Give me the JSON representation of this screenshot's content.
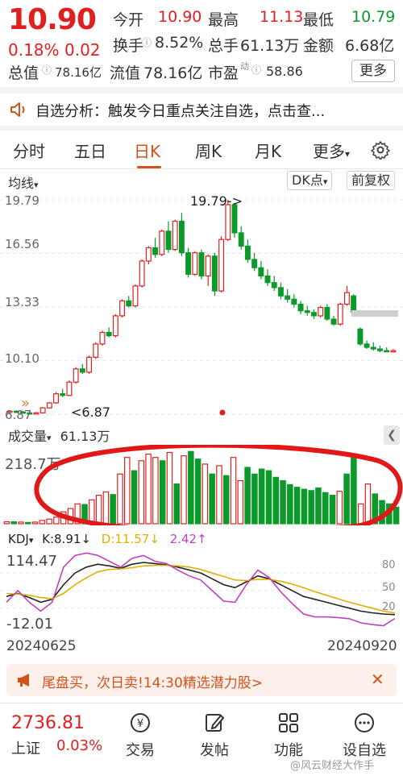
{
  "quote": {
    "price": "10.90",
    "change_pct": "0.18%",
    "change": "0.02",
    "rows": [
      [
        {
          "label": "今开",
          "value": "10.90",
          "color": "red"
        },
        {
          "label": "最高",
          "value": "11.13",
          "color": "red"
        },
        {
          "label": "最低",
          "value": "10.79",
          "color": "green"
        }
      ],
      [
        {
          "label": "换手",
          "value": "8.52%",
          "color": "gray"
        },
        {
          "label": "总手",
          "value": "61.13万",
          "color": "gray"
        },
        {
          "label": "金额",
          "value": "6.68亿",
          "color": "gray"
        }
      ],
      [
        {
          "label": "总值",
          "value": "78.16亿",
          "color": "gray"
        },
        {
          "label": "流值",
          "value": "78.16亿",
          "color": "gray"
        },
        {
          "label": "市盈",
          "value": "58.86",
          "color": "gray"
        }
      ]
    ],
    "more_button": "更多"
  },
  "notice": {
    "text": "自选分析：触发今日重点关注自选，点击查..."
  },
  "tabs": [
    {
      "label": "分时"
    },
    {
      "label": "五日"
    },
    {
      "label": "日K",
      "active": true
    },
    {
      "label": "周K"
    },
    {
      "label": "月K"
    },
    {
      "label": "更多"
    }
  ],
  "chart_toolbar": {
    "ma_label": "均线",
    "dk_label": "DK点",
    "adjust_label": "前复权"
  },
  "chart_data": [
    {
      "type": "candlestick",
      "y_ticks": [
        "19.79",
        "16.56",
        "13.33",
        "10.10",
        "6.87"
      ],
      "ylim": [
        6.87,
        19.79
      ],
      "annotations": {
        "max": "19.79->",
        "min": "<6.87"
      },
      "candles": [
        [
          7.0,
          7.1,
          6.95,
          7.05
        ],
        [
          7.05,
          7.1,
          6.95,
          7.0
        ],
        [
          7.0,
          7.05,
          6.9,
          6.95
        ],
        [
          6.95,
          7.0,
          6.88,
          6.92
        ],
        [
          6.92,
          7.0,
          6.87,
          6.95
        ],
        [
          6.95,
          7.3,
          6.9,
          7.25
        ],
        [
          7.25,
          7.6,
          7.2,
          7.55
        ],
        [
          7.55,
          8.2,
          7.5,
          8.1
        ],
        [
          8.1,
          8.4,
          7.9,
          8.0
        ],
        [
          8.0,
          8.9,
          7.95,
          8.8
        ],
        [
          8.8,
          9.7,
          8.7,
          9.6
        ],
        [
          9.6,
          9.9,
          9.3,
          9.4
        ],
        [
          9.4,
          10.4,
          9.3,
          10.3
        ],
        [
          10.3,
          11.2,
          10.2,
          11.1
        ],
        [
          11.1,
          11.9,
          11.0,
          11.8
        ],
        [
          11.8,
          12.1,
          11.5,
          11.6
        ],
        [
          11.6,
          12.9,
          11.5,
          12.8
        ],
        [
          12.8,
          13.8,
          12.7,
          13.7
        ],
        [
          13.7,
          14.0,
          13.3,
          13.4
        ],
        [
          13.4,
          14.7,
          13.3,
          14.6
        ],
        [
          14.6,
          16.2,
          14.5,
          16.1
        ],
        [
          16.1,
          17.0,
          15.9,
          16.9
        ],
        [
          16.9,
          17.5,
          16.3,
          16.5
        ],
        [
          16.5,
          18.0,
          16.4,
          17.9
        ],
        [
          17.9,
          18.5,
          16.6,
          16.8
        ],
        [
          16.8,
          18.6,
          16.7,
          18.5
        ],
        [
          18.5,
          19.0,
          16.4,
          16.6
        ],
        [
          16.6,
          16.9,
          15.1,
          15.3
        ],
        [
          15.3,
          16.7,
          15.2,
          16.6
        ],
        [
          16.6,
          16.8,
          15.0,
          15.2
        ],
        [
          15.2,
          16.5,
          14.6,
          16.4
        ],
        [
          16.4,
          16.6,
          14.0,
          14.3
        ],
        [
          14.3,
          17.6,
          14.2,
          17.4
        ],
        [
          17.4,
          19.79,
          17.3,
          19.5
        ],
        [
          19.5,
          19.6,
          17.5,
          17.8
        ],
        [
          17.8,
          18.2,
          16.8,
          17.0
        ],
        [
          17.0,
          17.4,
          16.0,
          16.2
        ],
        [
          16.2,
          16.6,
          15.5,
          15.7
        ],
        [
          15.7,
          16.1,
          15.0,
          15.2
        ],
        [
          15.2,
          15.6,
          14.6,
          14.8
        ],
        [
          14.8,
          15.2,
          14.3,
          14.5
        ],
        [
          14.5,
          14.8,
          13.8,
          14.0
        ],
        [
          14.0,
          14.4,
          13.6,
          13.8
        ],
        [
          13.8,
          14.1,
          13.3,
          13.5
        ],
        [
          13.5,
          13.7,
          12.9,
          13.1
        ],
        [
          13.1,
          13.4,
          12.8,
          13.0
        ],
        [
          13.0,
          13.2,
          12.6,
          12.8
        ],
        [
          12.8,
          13.4,
          12.7,
          13.3
        ],
        [
          13.3,
          13.5,
          12.5,
          12.6
        ],
        [
          12.6,
          12.8,
          12.2,
          12.3
        ],
        [
          12.3,
          13.6,
          12.2,
          13.5
        ],
        [
          13.5,
          14.6,
          13.4,
          14.2
        ],
        [
          14.0,
          14.1,
          12.9,
          13.0
        ],
        [
          12.0,
          12.1,
          11.0,
          11.1
        ],
        [
          11.1,
          11.3,
          10.8,
          10.9
        ],
        [
          10.9,
          11.2,
          10.7,
          10.8
        ],
        [
          10.8,
          11.0,
          10.6,
          10.7
        ],
        [
          10.7,
          10.9,
          10.6,
          10.65
        ],
        [
          10.65,
          10.8,
          10.6,
          10.7
        ]
      ]
    },
    {
      "type": "bar",
      "title": "成交量",
      "total_label": "61.13万",
      "y_tick": "218.7万",
      "ylim": [
        0,
        218.7
      ],
      "values": [
        6,
        6,
        5,
        4,
        5,
        10,
        14,
        20,
        36,
        46,
        60,
        58,
        72,
        86,
        96,
        88,
        150,
        200,
        160,
        190,
        210,
        200,
        190,
        215,
        120,
        205,
        218,
        195,
        180,
        150,
        175,
        145,
        200,
        130,
        170,
        150,
        165,
        160,
        140,
        130,
        118,
        110,
        104,
        100,
        108,
        94,
        86,
        98,
        150,
        200,
        60,
        120,
        90,
        70,
        60,
        50
      ],
      "rise": [
        1,
        0,
        1,
        0,
        1,
        1,
        1,
        1,
        1,
        1,
        1,
        0,
        1,
        1,
        1,
        0,
        1,
        1,
        0,
        1,
        1,
        1,
        0,
        1,
        0,
        1,
        0,
        0,
        1,
        0,
        1,
        0,
        1,
        1,
        0,
        0,
        0,
        0,
        0,
        0,
        0,
        0,
        0,
        0,
        0,
        0,
        0,
        1,
        0,
        0,
        1,
        1,
        0,
        0,
        0,
        0
      ]
    },
    {
      "type": "line",
      "title": "KDJ",
      "k_label": "K:8.91",
      "d_label": "D:11.57",
      "j_label": "2.42",
      "y_top": "114.47",
      "y_bottom": "-12.01",
      "right_ticks": [
        "80",
        "50",
        "20"
      ],
      "ylim": [
        -12.01,
        114.47
      ],
      "x_start": "20240625",
      "x_end": "20240920",
      "series": [
        {
          "color": "#222222",
          "values": [
            40,
            45,
            38,
            30,
            35,
            60,
            80,
            90,
            95,
            92,
            88,
            95,
            98,
            96,
            94,
            90,
            85,
            80,
            70,
            60,
            55,
            65,
            75,
            70,
            60,
            50,
            40,
            35,
            30,
            25,
            20,
            15,
            12,
            10,
            8.91
          ]
        },
        {
          "color": "#e0b000",
          "values": [
            45,
            44,
            42,
            38,
            36,
            45,
            60,
            72,
            82,
            86,
            87,
            89,
            92,
            93,
            93,
            92,
            90,
            86,
            80,
            74,
            68,
            67,
            69,
            69,
            66,
            61,
            55,
            48,
            42,
            36,
            30,
            25,
            20,
            15,
            11.57
          ]
        },
        {
          "color": "#c040c0",
          "values": [
            30,
            50,
            30,
            15,
            30,
            90,
            110,
            114,
            110,
            100,
            90,
            105,
            110,
            100,
            96,
            85,
            75,
            68,
            50,
            32,
            30,
            60,
            85,
            72,
            48,
            28,
            10,
            5,
            5,
            4,
            2,
            -5,
            -8,
            -10,
            2.42
          ]
        }
      ]
    }
  ],
  "ad_banner": {
    "text": "尾盘买，次日卖!14:30精选潜力股>"
  },
  "bottom_bar": {
    "index_value": "2736.81",
    "index_name": "上证",
    "index_change": "0.03%",
    "items": [
      {
        "label": "交易"
      },
      {
        "label": "发帖"
      },
      {
        "label": "功能"
      },
      {
        "label": "设自选"
      }
    ],
    "watermark": "@风云财经大作手"
  },
  "colors": {
    "up": "#e02020",
    "down": "#0a9a2a",
    "accent": "#d0521c",
    "highlight_circle": "#e01818"
  }
}
